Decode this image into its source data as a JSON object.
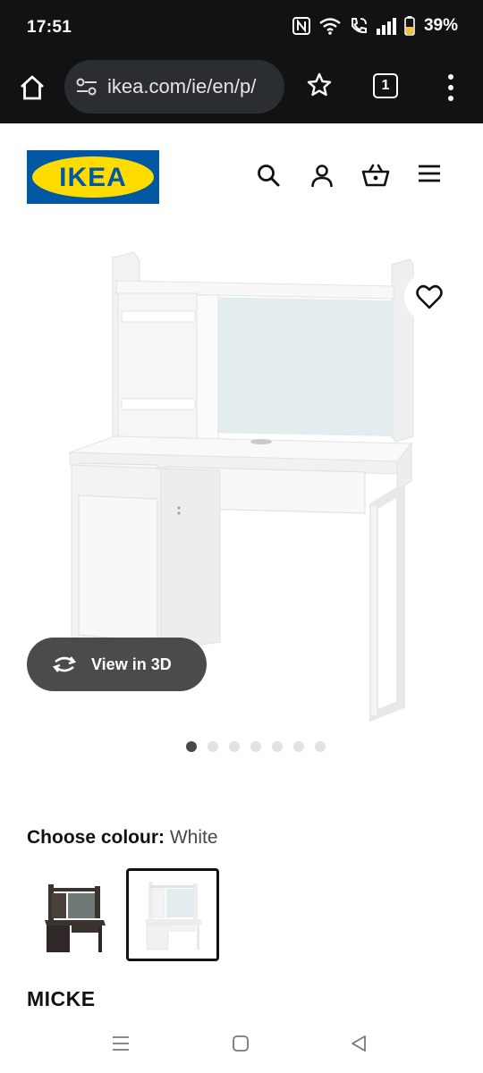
{
  "status_bar": {
    "time": "17:51",
    "battery": "39%",
    "icons": [
      "nfc-icon",
      "wifi-icon",
      "wifi-calling-icon",
      "signal-icon",
      "battery-icon"
    ]
  },
  "browser": {
    "url": "ikea.com/ie/en/p/",
    "tab_count": "1",
    "icons": [
      "home-icon",
      "site-settings-icon",
      "bookmark-star-icon",
      "tabs-icon",
      "more-menu-icon"
    ]
  },
  "header": {
    "logo_text": "IKEA",
    "icons": [
      "search-icon",
      "account-icon",
      "basket-icon",
      "hamburger-menu-icon"
    ]
  },
  "product": {
    "view_3d_label": "View in 3D",
    "image_count": 7,
    "active_image": 1,
    "colour_label": "Choose colour:",
    "colour_value": "White",
    "colour_options": [
      "black-brown",
      "white"
    ],
    "selected_colour": "white",
    "name": "MICKE"
  },
  "colors": {
    "ikea_blue": "#0058a3",
    "ikea_yellow": "#ffdb00",
    "status_bar": "#121212",
    "url_pill": "#2a2d31"
  }
}
